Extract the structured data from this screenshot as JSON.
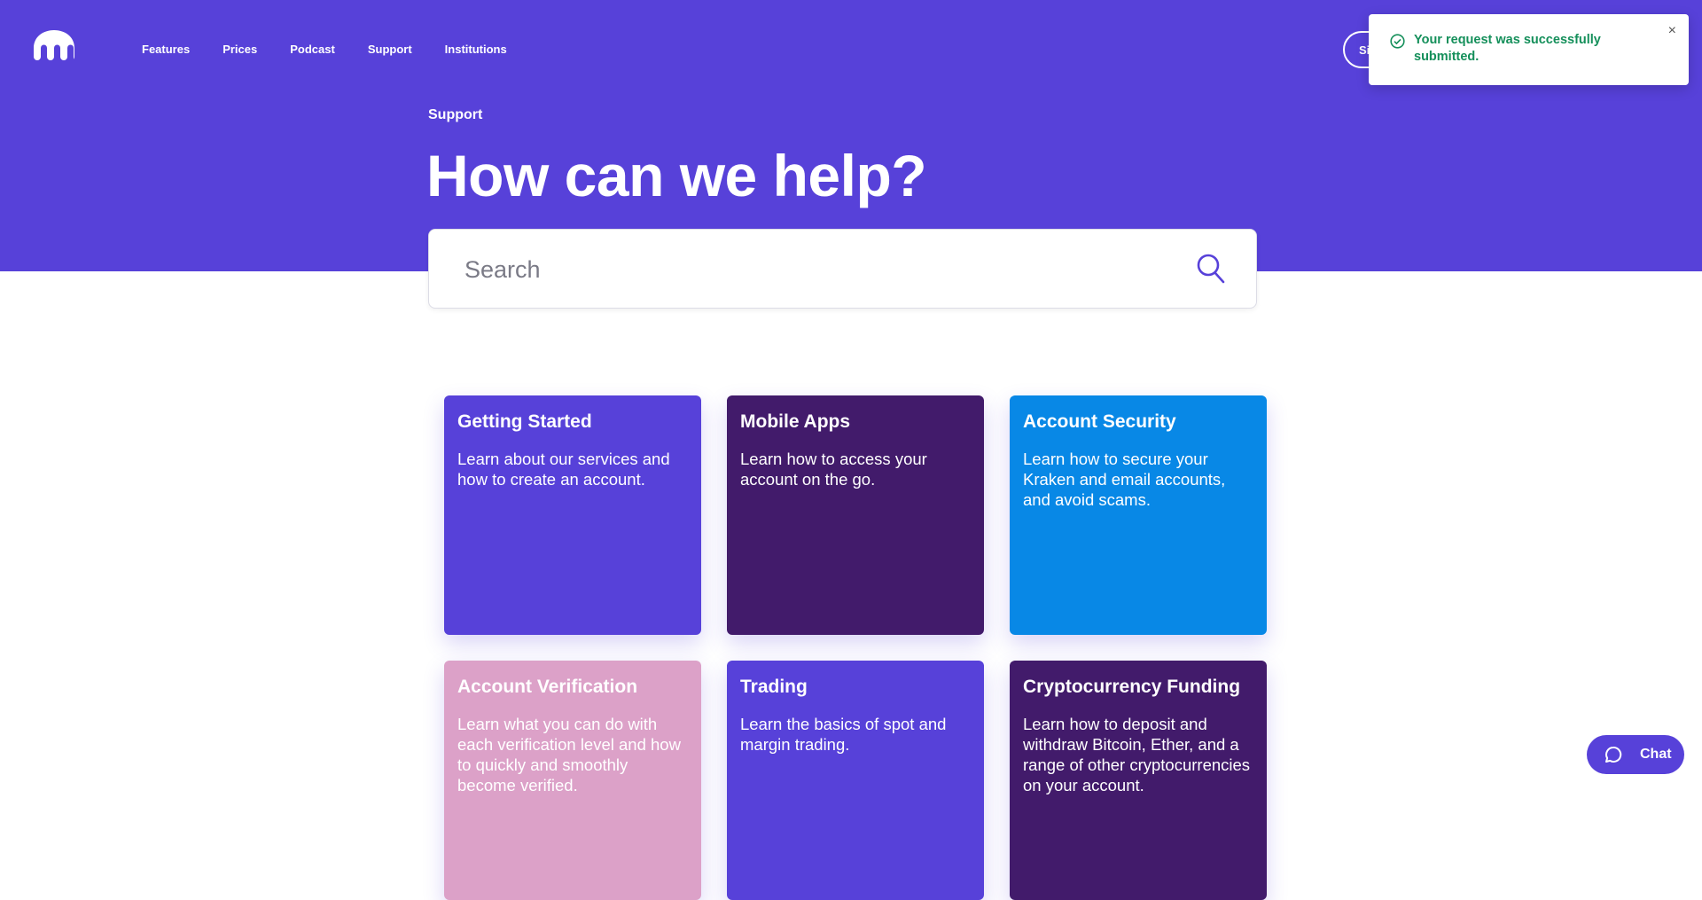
{
  "header": {
    "nav": [
      "Features",
      "Prices",
      "Podcast",
      "Support",
      "Institutions"
    ],
    "signup_label": "Si"
  },
  "hero": {
    "breadcrumb": "Support",
    "title": "How can we help?"
  },
  "search": {
    "placeholder": "Search"
  },
  "toast": {
    "message": "Your request was successfully submitted.",
    "close_label": "×"
  },
  "cards": [
    {
      "title": "Getting Started",
      "description": "Learn about our services and how to create an account.",
      "color": "#5741d9"
    },
    {
      "title": "Mobile Apps",
      "description": "Learn how to access your account on the go.",
      "color": "#421b6b"
    },
    {
      "title": "Account Security",
      "description": "Learn how to secure your Kraken and email accounts, and avoid scams.",
      "color": "#0888e6"
    },
    {
      "title": "Account Verification",
      "description": "Learn what you can do with each verification level and how to quickly and smoothly become verified.",
      "color": "#dca1c8"
    },
    {
      "title": "Trading",
      "description": "Learn the basics of spot and margin trading.",
      "color": "#5741d9"
    },
    {
      "title": "Cryptocurrency Funding",
      "description": "Learn how to deposit and withdraw Bitcoin, Ether, and a range of other cryptocurrencies on your account.",
      "color": "#421b6b"
    }
  ],
  "chat": {
    "label": "Chat"
  },
  "colors": {
    "brand": "#5741d9",
    "success": "#148f5a"
  }
}
